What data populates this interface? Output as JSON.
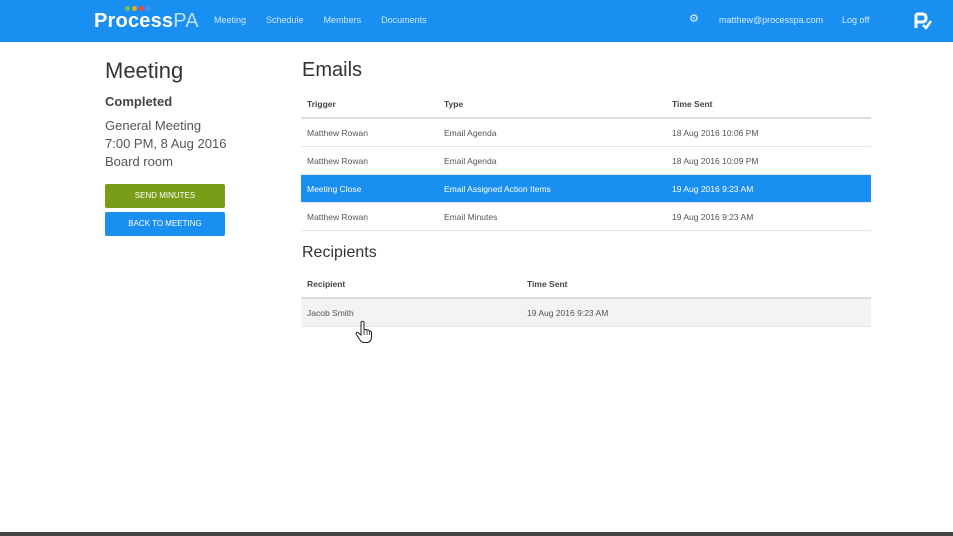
{
  "header": {
    "logo_main": "Process",
    "logo_suffix": "PA",
    "nav": [
      "Meeting",
      "Schedule",
      "Members",
      "Documents"
    ],
    "user_email": "matthew@processpa.com",
    "logoff_label": "Log off",
    "accent_color": "#1a8ff2"
  },
  "meeting": {
    "heading": "Meeting",
    "status": "Completed",
    "type": "General Meeting",
    "datetime": "7:00 PM, 8 Aug 2016",
    "location": "Board room",
    "send_minutes_label": "SEND MINUTES",
    "back_label": "BACK TO MEETING"
  },
  "emails": {
    "title": "Emails",
    "headers": [
      "Trigger",
      "Type",
      "Time Sent"
    ],
    "rows": [
      {
        "trigger": "Matthew Rowan",
        "type": "Email Agenda",
        "time": "18 Aug 2016 10:06 PM"
      },
      {
        "trigger": "Matthew Rowan",
        "type": "Email Agenda",
        "time": "18 Aug 2016 10:09 PM"
      },
      {
        "trigger": "Meeting Close",
        "type": "Email Assigned Action Items",
        "time": "19 Aug 2016 9:23 AM"
      },
      {
        "trigger": "Matthew Rowan",
        "type": "Email Minutes",
        "time": "19 Aug 2016 9:23 AM"
      }
    ]
  },
  "recipients": {
    "title": "Recipients",
    "headers": [
      "Recipient",
      "Time Sent"
    ],
    "rows": [
      {
        "recipient": "Jacob Smith",
        "time": "19 Aug 2016 9:23 AM"
      }
    ]
  }
}
